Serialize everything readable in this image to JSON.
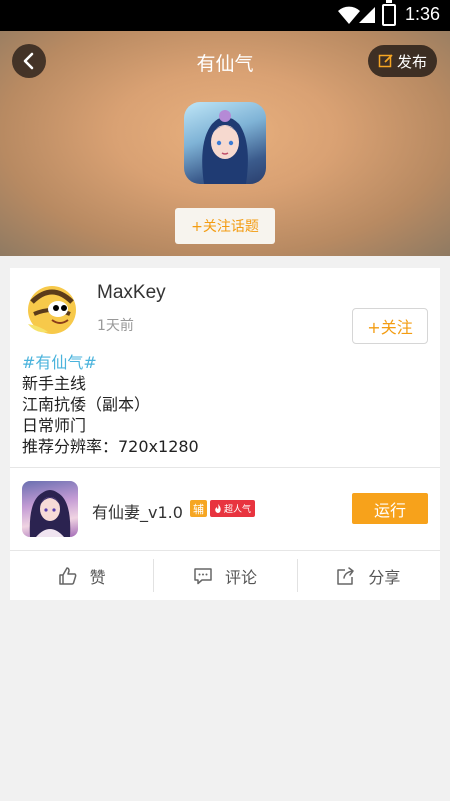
{
  "status_bar": {
    "time": "1:36"
  },
  "header": {
    "title": "有仙气",
    "publish_label": "发布",
    "follow_topic_label": "+关注话题"
  },
  "post": {
    "username": "MaxKey",
    "time": "1天前",
    "follow_label": "+关注",
    "hashtag": "#有仙气#",
    "lines": [
      "新手主线",
      "江南抗倭（副本）",
      "日常师门",
      "推荐分辨率：720x1280"
    ]
  },
  "game": {
    "name": "有仙妻_v1.0",
    "badge_fu": "辅",
    "badge_hot": "超人气",
    "run_label": "运行"
  },
  "actions": {
    "like_label": "赞",
    "comment_label": "评论",
    "share_label": "分享"
  },
  "colors": {
    "accent": "#f7a21b",
    "hashtag": "#4ab3dc",
    "hot_badge": "#e8343f"
  }
}
